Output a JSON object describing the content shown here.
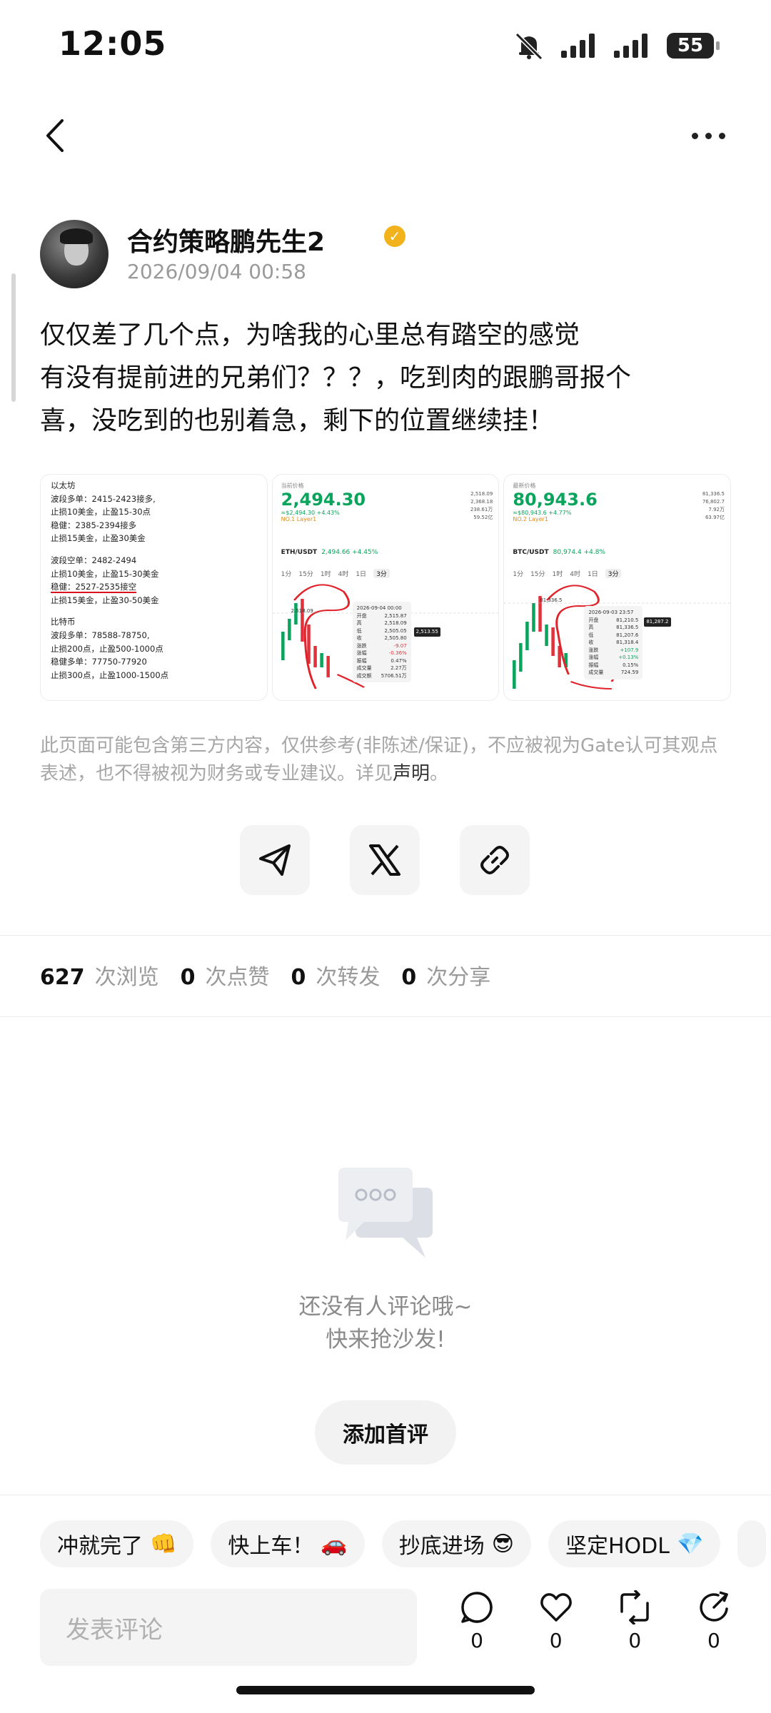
{
  "status_bar": {
    "time": "12:05",
    "battery": "55"
  },
  "author": {
    "name": "合约策略鹏先生2",
    "post_time": "2026/09/04 00:58"
  },
  "post": {
    "lines": [
      "仅仅差了几个点，为啥我的心里总有踏空的感觉",
      "有没有提前进的兄弟们？？？，吃到肉的跟鹏哥报个",
      "喜，没吃到的也别着急，剩下的位置继续挂！"
    ]
  },
  "images": {
    "note": {
      "title": "以太坊",
      "block1": [
        "波段多单：2415-2423接多,",
        "止损10美金，止盈15-30点",
        "稳健：2385-2394接多",
        "止损15美金，止盈30美金"
      ],
      "block2": [
        "波段空单：2482-2494",
        "止损10美金，止盈15-30美金",
        "稳健：2527-2535接空",
        "止损15美金，止盈30-50美金"
      ],
      "block3_title": "比特币",
      "block3": [
        "波段多单：78588-78750,",
        "止损200点，止盈500-1000点",
        "稳健多单：77750-77920",
        "止损300点，止盈1000-1500点"
      ]
    },
    "eth_chart": {
      "label": "当前价格",
      "price": "2,494.30",
      "sub": "≈$2,494.30 +4.43%",
      "tag": "NO.1  Layer1",
      "stats": [
        "2,518.09",
        "2,368.18",
        "238.61万",
        "59.52亿"
      ],
      "pair": "ETH/USDT",
      "pair_change": "2,494.66 +4.45%",
      "timeframes": [
        "1分",
        "15分",
        "1时",
        "4时",
        "1日",
        "3分"
      ],
      "high_label": "2,518.09",
      "tooltip_date": "2026-09-04 00:00",
      "tooltip": [
        [
          "开盘",
          "2,515.87"
        ],
        [
          "高",
          "2,518.09"
        ],
        [
          "低",
          "2,505.05"
        ],
        [
          "收",
          "2,505.80"
        ],
        [
          "涨跌",
          "-9.07"
        ],
        [
          "涨幅",
          "-0.36%"
        ],
        [
          "振幅",
          "0.47%"
        ],
        [
          "成交量",
          "2.27万"
        ],
        [
          "成交额",
          "5706.51万"
        ]
      ],
      "price_tag": "2,513.55"
    },
    "btc_chart": {
      "label": "最新价格",
      "price": "80,943.6",
      "sub": "≈$80,943.6 +4.77%",
      "tag": "NO.2  Layer1",
      "stats": [
        "81,336.5",
        "76,802.7",
        "7.92万",
        "63.97亿"
      ],
      "pair": "BTC/USDT",
      "pair_change": "80,974.4 +4.8%",
      "timeframes": [
        "1分",
        "15分",
        "1时",
        "4时",
        "1日",
        "3分"
      ],
      "high_label": "81,336.5",
      "tooltip_date": "2026-09-03 23:57",
      "tooltip": [
        [
          "开盘",
          "81,210.5"
        ],
        [
          "高",
          "81,336.5"
        ],
        [
          "低",
          "81,207.6"
        ],
        [
          "收",
          "81,318.4"
        ],
        [
          "涨跌",
          "+107.9"
        ],
        [
          "涨幅",
          "+0.13%"
        ],
        [
          "振幅",
          "0.15%"
        ],
        [
          "成交量",
          "724.59"
        ]
      ],
      "price_tag": "81,287.2"
    }
  },
  "disclaimer": {
    "text": "此页面可能包含第三方内容，仅供参考(非陈述/保证)，不应被视为Gate认可其观点表述，也不得被视为财务或专业建议。详见",
    "link": "声明",
    "end": "。"
  },
  "stats": {
    "views": "627",
    "views_label": "次浏览",
    "likes": "0",
    "likes_label": "次点赞",
    "reposts": "0",
    "reposts_label": "次转发",
    "shares": "0",
    "shares_label": "次分享"
  },
  "comments": {
    "empty_line1": "还没有人评论哦~",
    "empty_line2": "快来抢沙发!",
    "first_button": "添加首评"
  },
  "quick_replies": [
    {
      "label": "冲就完了",
      "emoji": "👊"
    },
    {
      "label": "快上车！",
      "emoji": "🚗"
    },
    {
      "label": "抄底进场",
      "emoji": "😎"
    },
    {
      "label": "坚定HODL",
      "emoji": "💎"
    }
  ],
  "bottom_bar": {
    "input_placeholder": "发表评论",
    "comment_count": "0",
    "like_count": "0",
    "repost_count": "0",
    "share_count": "0"
  }
}
